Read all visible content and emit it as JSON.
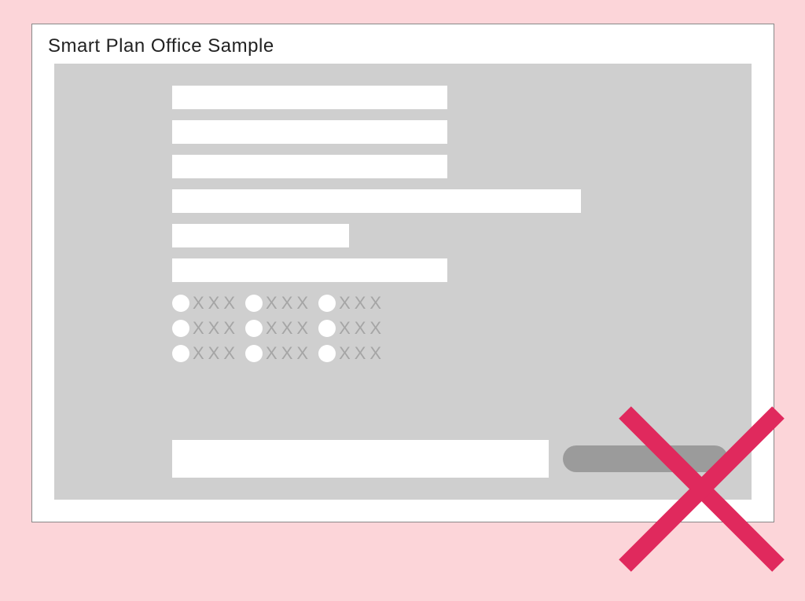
{
  "window": {
    "title": "Smart Plan Office Sample"
  },
  "form": {
    "fields": [
      {
        "value": "",
        "width": "w1"
      },
      {
        "value": "",
        "width": "w1"
      },
      {
        "value": "",
        "width": "w1"
      },
      {
        "value": "",
        "width": "w2"
      },
      {
        "value": "",
        "width": "w3"
      },
      {
        "value": "",
        "width": "w1"
      }
    ],
    "radioRows": [
      {
        "options": [
          {
            "label": "XXX"
          },
          {
            "label": "XXX"
          },
          {
            "label": "XXX"
          }
        ]
      },
      {
        "options": [
          {
            "label": "XXX"
          },
          {
            "label": "XXX"
          },
          {
            "label": "XXX"
          }
        ]
      },
      {
        "options": [
          {
            "label": "XXX"
          },
          {
            "label": "XXX"
          },
          {
            "label": "XXX"
          }
        ]
      }
    ],
    "bottom": {
      "field_value": "",
      "button_label": ""
    }
  },
  "overlay": {
    "x_color": "#e0295d"
  }
}
